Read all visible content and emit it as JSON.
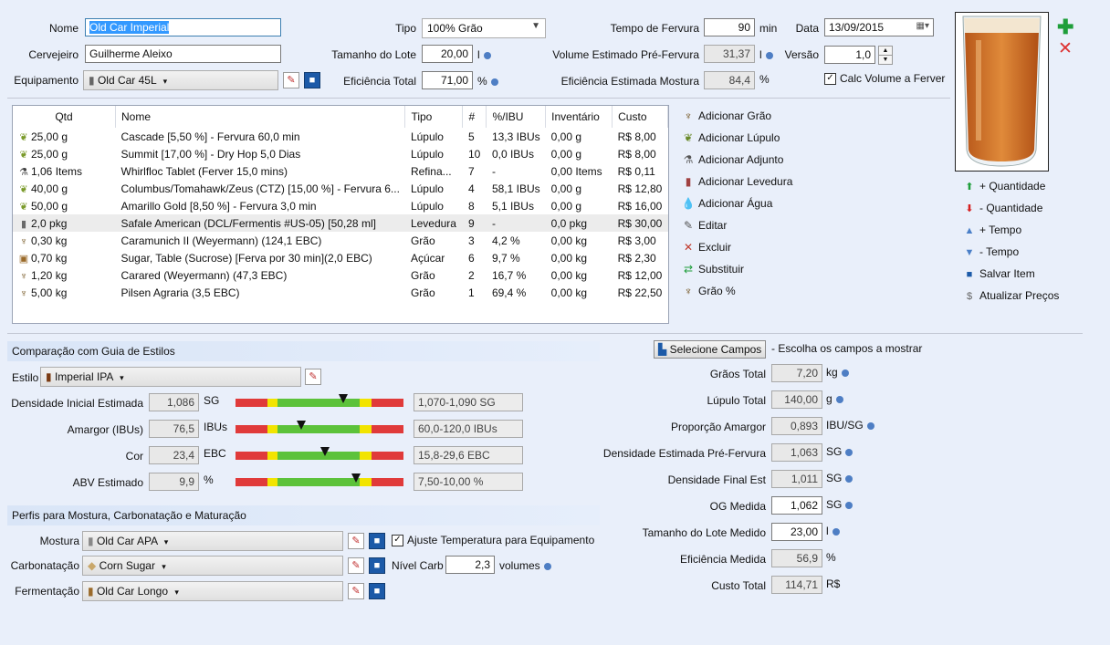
{
  "header": {
    "nome_label": "Nome",
    "nome_value": "Old Car Imperial",
    "cervejeiro_label": "Cervejeiro",
    "cervejeiro_value": "Guilherme Aleixo",
    "equipamento_label": "Equipamento",
    "equipamento_value": "Old Car 45L",
    "tipo_label": "Tipo",
    "tipo_value": "100% Grão",
    "lote_label": "Tamanho do Lote",
    "lote_value": "20,00",
    "lote_unit": "l",
    "eficiencia_label": "Eficiência Total",
    "eficiencia_value": "71,00",
    "eficiencia_unit": "%",
    "fervura_label": "Tempo de Fervura",
    "fervura_value": "90",
    "fervura_unit": "min",
    "volume_label": "Volume Estimado Pré-Fervura",
    "volume_value": "31,37",
    "volume_unit": "l",
    "ef_mostura_label": "Eficiência Estimada Mostura",
    "ef_mostura_value": "84,4",
    "ef_mostura_unit": "%",
    "data_label": "Data",
    "data_value": "13/09/2015",
    "versao_label": "Versão",
    "versao_value": "1,0",
    "calc_label": "Calc Volume a Ferver",
    "calc_checked": "✓"
  },
  "ingredients": {
    "columns": [
      "Qtd",
      "Nome",
      "Tipo",
      "#",
      "%/IBU",
      "Inventário",
      "Custo"
    ],
    "rows": [
      {
        "icon": "hop-icon",
        "glyph": "❦",
        "qtd": "25,00 g",
        "nome": "Cascade [5,50 %] - Fervura 60,0 min",
        "tipo": "Lúpulo",
        "num": "5",
        "ibu": "13,3 IBUs",
        "inv": "0,00 g",
        "custo": "R$ 8,00"
      },
      {
        "icon": "hop-icon",
        "glyph": "❦",
        "qtd": "25,00 g",
        "nome": "Summit [17,00 %] - Dry Hop 5,0 Dias",
        "tipo": "Lúpulo",
        "num": "10",
        "ibu": "0,0 IBUs",
        "inv": "0,00 g",
        "custo": "R$ 8,00"
      },
      {
        "icon": "adjunct-icon",
        "glyph": "⚗",
        "qtd": "1,06 Items",
        "nome": "Whirlfloc Tablet (Ferver 15,0 mins)",
        "tipo": "Refina...",
        "num": "7",
        "ibu": "-",
        "inv": "0,00 Items",
        "custo": "R$ 0,11"
      },
      {
        "icon": "hop-icon",
        "glyph": "❦",
        "qtd": "40,00 g",
        "nome": "Columbus/Tomahawk/Zeus (CTZ) [15,00 %] - Fervura 6...",
        "tipo": "Lúpulo",
        "num": "4",
        "ibu": "58,1 IBUs",
        "inv": "0,00 g",
        "custo": "R$ 12,80"
      },
      {
        "icon": "hop-icon",
        "glyph": "❦",
        "qtd": "50,00 g",
        "nome": "Amarillo Gold [8,50 %] - Fervura 3,0 min",
        "tipo": "Lúpulo",
        "num": "8",
        "ibu": "5,1 IBUs",
        "inv": "0,00 g",
        "custo": "R$ 16,00"
      },
      {
        "icon": "yeast-icon",
        "glyph": "▮",
        "qtd": "2,0 pkg",
        "nome": "Safale American  (DCL/Fermentis #US-05) [50,28 ml]",
        "tipo": "Levedura",
        "num": "9",
        "ibu": "-",
        "inv": "0,0 pkg",
        "custo": "R$ 30,00"
      },
      {
        "icon": "grain-icon",
        "glyph": "♆",
        "qtd": "0,30 kg",
        "nome": "Caramunich II (Weyermann) (124,1 EBC)",
        "tipo": "Grão",
        "num": "3",
        "ibu": "4,2 %",
        "inv": "0,00 kg",
        "custo": "R$ 3,00"
      },
      {
        "icon": "sugar-icon",
        "glyph": "▣",
        "qtd": "0,70 kg",
        "nome": "Sugar, Table (Sucrose) [Ferva por 30 min](2,0 EBC)",
        "tipo": "Açúcar",
        "num": "6",
        "ibu": "9,7 %",
        "inv": "0,00 kg",
        "custo": "R$ 2,30"
      },
      {
        "icon": "grain-icon",
        "glyph": "♆",
        "qtd": "1,20 kg",
        "nome": "Carared (Weyermann) (47,3 EBC)",
        "tipo": "Grão",
        "num": "2",
        "ibu": "16,7 %",
        "inv": "0,00 kg",
        "custo": "R$ 12,00"
      },
      {
        "icon": "grain-icon",
        "glyph": "♆",
        "qtd": "5,00 kg",
        "nome": "Pilsen Agraria (3,5 EBC)",
        "tipo": "Grão",
        "num": "1",
        "ibu": "69,4 %",
        "inv": "0,00 kg",
        "custo": "R$ 22,50"
      }
    ]
  },
  "actions": [
    {
      "label": "Adicionar Grão",
      "icon": "grain-icon",
      "glyph": "♆",
      "color": "#6b4a12"
    },
    {
      "label": "Adicionar Lúpulo",
      "icon": "hop-icon",
      "glyph": "❦",
      "color": "#6a8a2a"
    },
    {
      "label": "Adicionar Adjunto",
      "icon": "adjunct-icon",
      "glyph": "⚗",
      "color": "#555555"
    },
    {
      "label": "Adicionar Levedura",
      "icon": "yeast-icon",
      "glyph": "▮",
      "color": "#a04040"
    },
    {
      "label": "Adicionar Água",
      "icon": "water-drop-icon",
      "glyph": "💧",
      "color": "#3a6fc0"
    },
    {
      "label": "Editar",
      "icon": "edit-icon",
      "glyph": "✎",
      "color": "#555555"
    },
    {
      "label": "Excluir",
      "icon": "delete-icon",
      "glyph": "✕",
      "color": "#c0392b"
    },
    {
      "label": "Substituir",
      "icon": "replace-icon",
      "glyph": "⇄",
      "color": "#1e9e3a"
    },
    {
      "label": "Grão %",
      "icon": "grain-percent-icon",
      "glyph": "♆",
      "color": "#6b4a12"
    }
  ],
  "right_actions": [
    {
      "label": "+ Quantidade",
      "icon": "arrow-up-icon",
      "glyph": "⬆",
      "color": "#1e9e3a"
    },
    {
      "label": "- Quantidade",
      "icon": "arrow-down-icon",
      "glyph": "⬇",
      "color": "#d62020"
    },
    {
      "label": "+ Tempo",
      "icon": "triangle-up-icon",
      "glyph": "▲",
      "color": "#4a7fc8"
    },
    {
      "label": "- Tempo",
      "icon": "triangle-down-icon",
      "glyph": "▼",
      "color": "#4a7fc8"
    },
    {
      "label": "Salvar Item",
      "icon": "save-icon",
      "glyph": "■",
      "color": "#1c5aa8"
    },
    {
      "label": "Atualizar Preços",
      "icon": "dollar-icon",
      "glyph": "$",
      "color": "#666666"
    }
  ],
  "style_guide": {
    "header": "Comparação com Guia de Estilos",
    "estilo_label": "Estilo",
    "estilo_value": "Imperial IPA",
    "rows": [
      {
        "label": "Densidade Inicial Estimada",
        "value": "1,086",
        "unit": "SG",
        "range": "1,070-1,090 SG",
        "marker": 0.64
      },
      {
        "label": "Amargor (IBUs)",
        "value": "76,5",
        "unit": "IBUs",
        "range": "60,0-120,0 IBUs",
        "marker": 0.39
      },
      {
        "label": "Cor",
        "value": "23,4",
        "unit": "EBC",
        "range": "15,8-29,6 EBC",
        "marker": 0.53
      },
      {
        "label": "ABV Estimado",
        "value": "9,9",
        "unit": "%",
        "range": "7,50-10,00 %",
        "marker": 0.72
      }
    ]
  },
  "profiles": {
    "header": "Perfis para Mostura, Carbonatação e Maturação",
    "mostura_label": "Mostura",
    "mostura_value": "Old Car APA",
    "ajuste_label": "Ajuste Temperatura para Equipamento",
    "ajuste_checked": "✓",
    "carb_label": "Carbonatação",
    "carb_value": "Corn Sugar",
    "nivel_label": "Nível Carb",
    "nivel_value": "2,3",
    "nivel_unit": "volumes",
    "ferm_label": "Fermentação",
    "ferm_value": "Old Car Longo"
  },
  "stats": {
    "select_button": "Selecione Campos",
    "select_hint": "- Escolha os campos a mostrar",
    "rows": [
      {
        "label": "Grãos Total",
        "value": "7,20",
        "unit": "kg",
        "editable": false
      },
      {
        "label": "Lúpulo Total",
        "value": "140,00",
        "unit": "g",
        "editable": false
      },
      {
        "label": "Proporção Amargor",
        "value": "0,893",
        "unit": "IBU/SG",
        "editable": false
      },
      {
        "label": "Densidade Estimada Pré-Fervura",
        "value": "1,063",
        "unit": "SG",
        "editable": false
      },
      {
        "label": "Densidade Final Est",
        "value": "1,011",
        "unit": "SG",
        "editable": false
      },
      {
        "label": "OG Medida",
        "value": "1,062",
        "unit": "SG",
        "editable": true
      },
      {
        "label": "Tamanho do Lote Medido",
        "value": "23,00",
        "unit": "l",
        "editable": true
      },
      {
        "label": "Eficiência Medida",
        "value": "56,9",
        "unit": "%",
        "editable": false
      },
      {
        "label": "Custo Total",
        "value": "114,71",
        "unit": "R$",
        "editable": false
      }
    ]
  },
  "colors": {
    "accent": "#3399ff",
    "bar_red": "#e03a3a",
    "bar_yellow": "#f2e400",
    "bar_green": "#5cc23a",
    "beer": "#d2691e"
  }
}
